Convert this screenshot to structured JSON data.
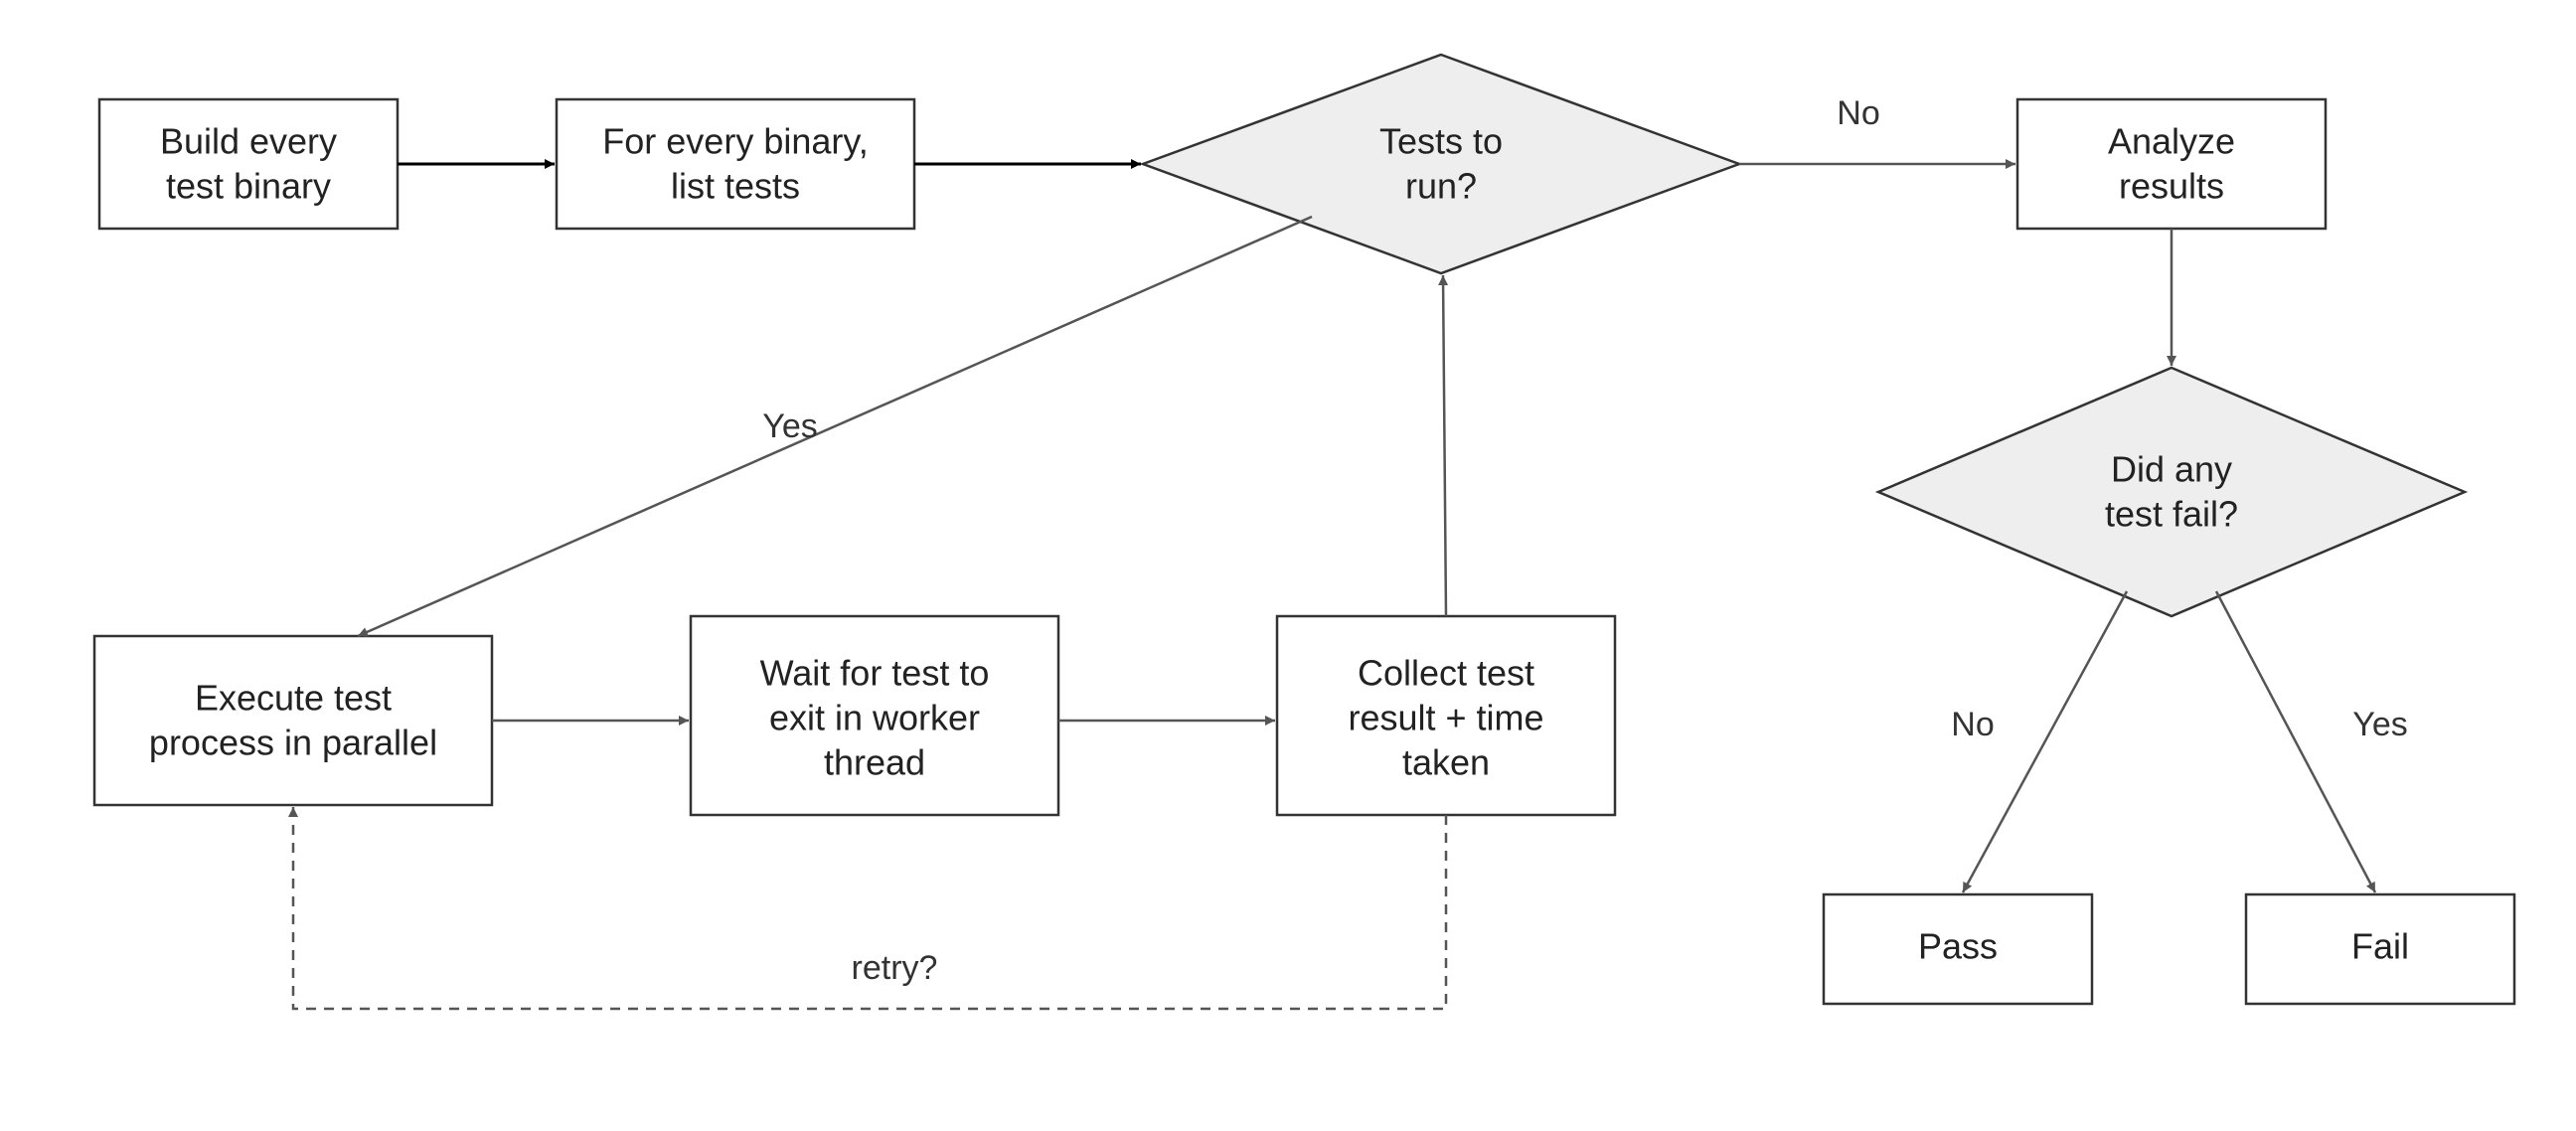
{
  "nodes": {
    "build": {
      "line1": "Build every",
      "line2": "test binary"
    },
    "list": {
      "line1": "For every binary,",
      "line2": "list tests"
    },
    "tests_q": {
      "line1": "Tests to",
      "line2": "run?"
    },
    "analyze": {
      "line1": "Analyze",
      "line2": "results"
    },
    "execute": {
      "line1": "Execute test",
      "line2": "process in parallel"
    },
    "wait": {
      "line1": "Wait for test to",
      "line2": "exit in worker",
      "line3": "thread"
    },
    "collect": {
      "line1": "Collect test",
      "line2": "result + time",
      "line3": "taken"
    },
    "fail_q": {
      "line1": "Did any",
      "line2": "test fail?"
    },
    "pass": {
      "line1": "Pass"
    },
    "fail": {
      "line1": "Fail"
    }
  },
  "edges": {
    "yes": "Yes",
    "no": "No",
    "retry": "retry?"
  }
}
